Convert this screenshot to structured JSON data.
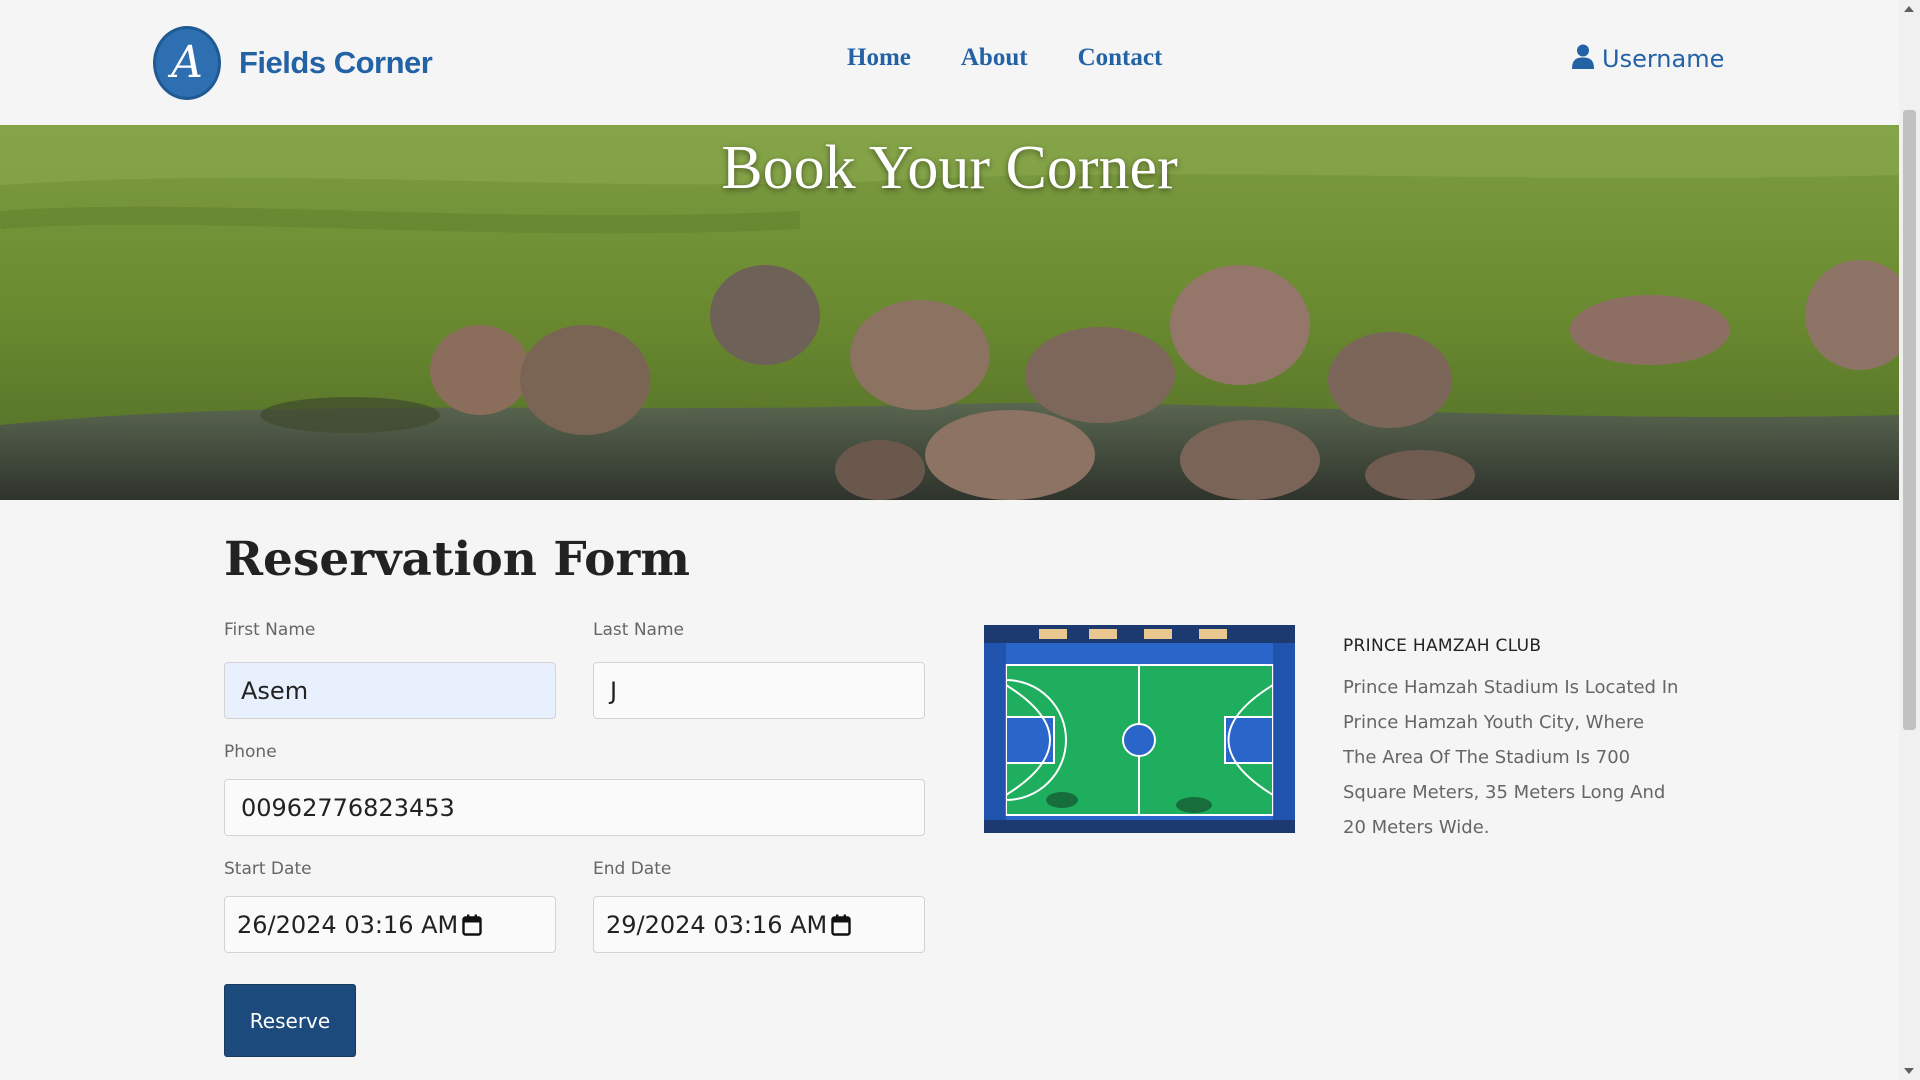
{
  "header": {
    "brand_name": "Fields Corner",
    "logo_letter": "A",
    "nav": {
      "home": "Home",
      "about": "About",
      "contact": "Contact"
    },
    "username": "Username"
  },
  "hero": {
    "title": "Book Your Corner"
  },
  "form": {
    "title": "Reservation Form",
    "first_name": {
      "label": "First Name",
      "value": "Asem"
    },
    "last_name": {
      "label": "Last Name",
      "value": "J"
    },
    "phone": {
      "label": "Phone",
      "value": "00962776823453"
    },
    "start_date": {
      "label": "Start Date",
      "value": "26/2024 03:16 AM"
    },
    "end_date": {
      "label": "End Date",
      "value": "29/2024 03:16 AM"
    },
    "reserve_label": "Reserve"
  },
  "club": {
    "name": "PRINCE HAMZAH CLUB",
    "description": "Prince Hamzah Stadium Is Located In Prince Hamzah Youth City, Where The Area Of The Stadium Is 700 Square Meters, 35 Meters Long And 20 Meters Wide."
  },
  "colors": {
    "brand_blue": "#2462a6",
    "button_blue": "#1d4a7c",
    "autofill_bg": "#e8f0fe"
  },
  "icons": {
    "user": "user-icon",
    "calendar": "calendar-icon",
    "logo": "logo-icon"
  }
}
